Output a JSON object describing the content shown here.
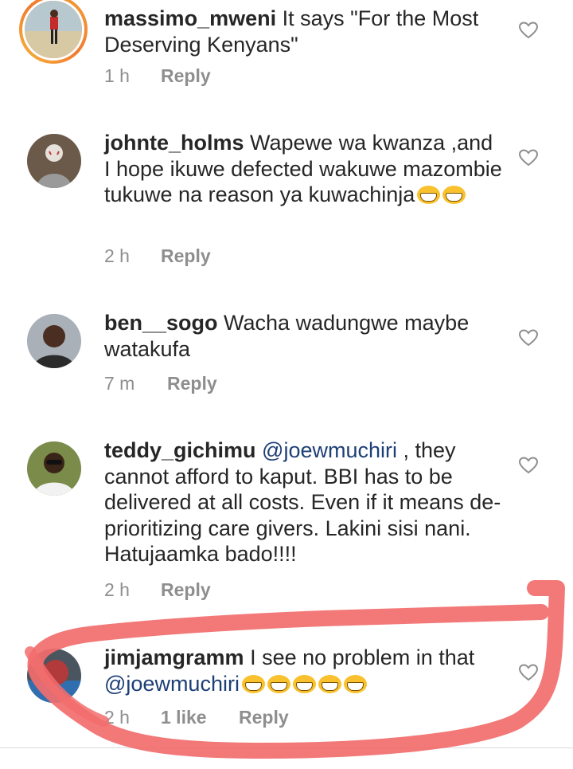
{
  "comments": [
    {
      "username": "massimo_mweni",
      "text": "It says \"For the Most Deserving Kenyans\"",
      "time": "1 h",
      "reply_label": "Reply"
    },
    {
      "username": "johnte_holms",
      "text": "Wapewe wa kwanza ,and I hope ikuwe defected wakuwe mazombie tukuwe na reason ya kuwachinja",
      "emojis": [
        "grin-emoji",
        "grin-emoji"
      ],
      "time": "2 h",
      "reply_label": "Reply"
    },
    {
      "username": "ben__sogo",
      "text": "Wacha wadungwe maybe watakufa",
      "time": "7 m",
      "reply_label": "Reply"
    },
    {
      "username": "teddy_gichimu",
      "mention": "@joewmuchiri",
      "text": ", they cannot afford to kaput. BBI has to be delivered at all costs. Even if it means de-prioritizing care givers. Lakini sisi nani. Hatujaamka bado!!!!",
      "time": "2 h",
      "reply_label": "Reply"
    },
    {
      "username": "jimjamgramm",
      "text": "I see no problem in that",
      "mention": "@joewmuchiri",
      "emojis": [
        "grin-emoji",
        "grin-emoji",
        "grin-emoji",
        "grin-emoji",
        "grin-emoji"
      ],
      "time": "2 h",
      "likes": "1 like",
      "reply_label": "Reply"
    }
  ],
  "icons": {
    "like": "heart-outline-icon"
  },
  "colors": {
    "mention": "#1d3f76",
    "meta": "#8e8e8e",
    "annotation": "#f26d6d"
  }
}
